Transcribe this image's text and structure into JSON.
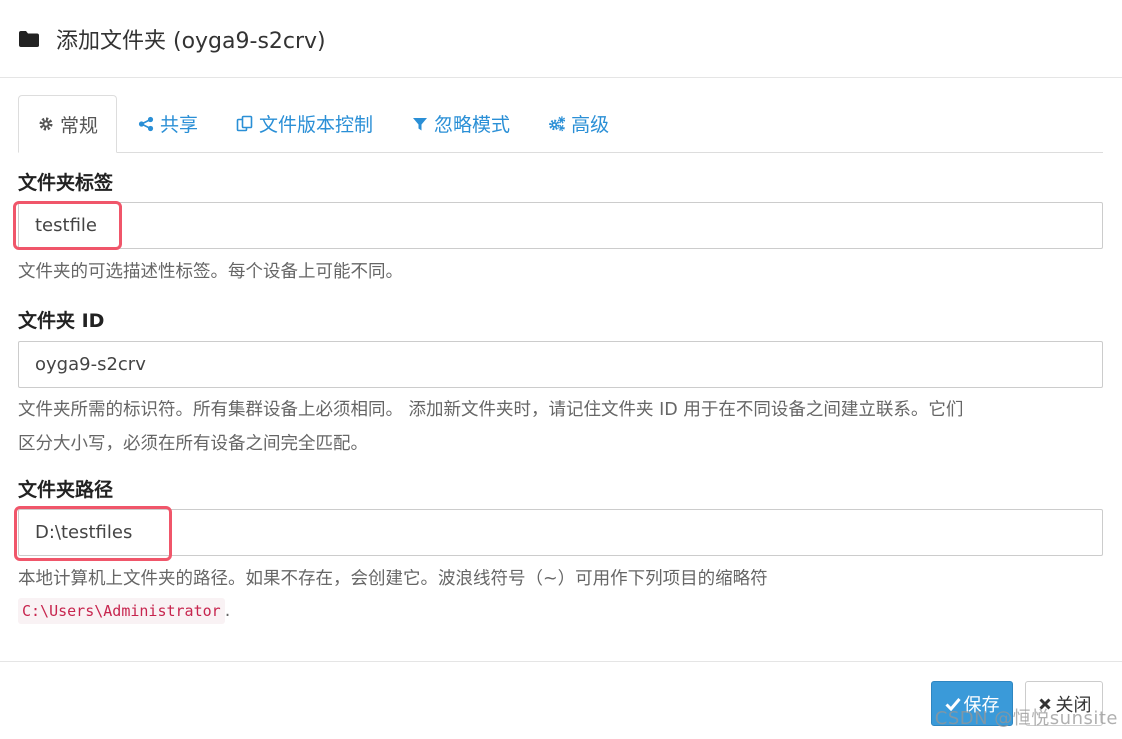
{
  "header": {
    "title": "添加文件夹 (oyga9-s2crv)",
    "icon": "folder-icon"
  },
  "tabs": [
    {
      "label": "常规",
      "icon": "gear-icon",
      "active": true
    },
    {
      "label": "共享",
      "icon": "share-icon",
      "active": false
    },
    {
      "label": "文件版本控制",
      "icon": "copy-icon",
      "active": false
    },
    {
      "label": "忽略模式",
      "icon": "filter-icon",
      "active": false
    },
    {
      "label": "高级",
      "icon": "cogs-icon",
      "active": false
    }
  ],
  "fields": {
    "label": {
      "title": "文件夹标签",
      "value": "testfile",
      "help": "文件夹的可选描述性标签。每个设备上可能不同。"
    },
    "id": {
      "title": "文件夹 ID",
      "value": "oyga9-s2crv",
      "help_line1": "文件夹所需的标识符。所有集群设备上必须相同。 添加新文件夹时，请记住文件夹 ID 用于在不同设备之间建立联系。它们",
      "help_line2": "区分大小写，必须在所有设备之间完全匹配。"
    },
    "path": {
      "title": "文件夹路径",
      "value": "D:\\testfiles",
      "help": "本地计算机上文件夹的路径。如果不存在，会创建它。波浪线符号（~）可用作下列项目的缩略符",
      "home_code": "C:\\Users\\Administrator",
      "home_suffix": "."
    }
  },
  "footer": {
    "save_label": "保存",
    "close_label": "关闭"
  },
  "watermark": "CSDN @恒悦sunsite",
  "colors": {
    "link": "#2a8fd6",
    "primary": "#3a9ad9",
    "highlight": "#f0566a",
    "code": "#c7254e"
  }
}
